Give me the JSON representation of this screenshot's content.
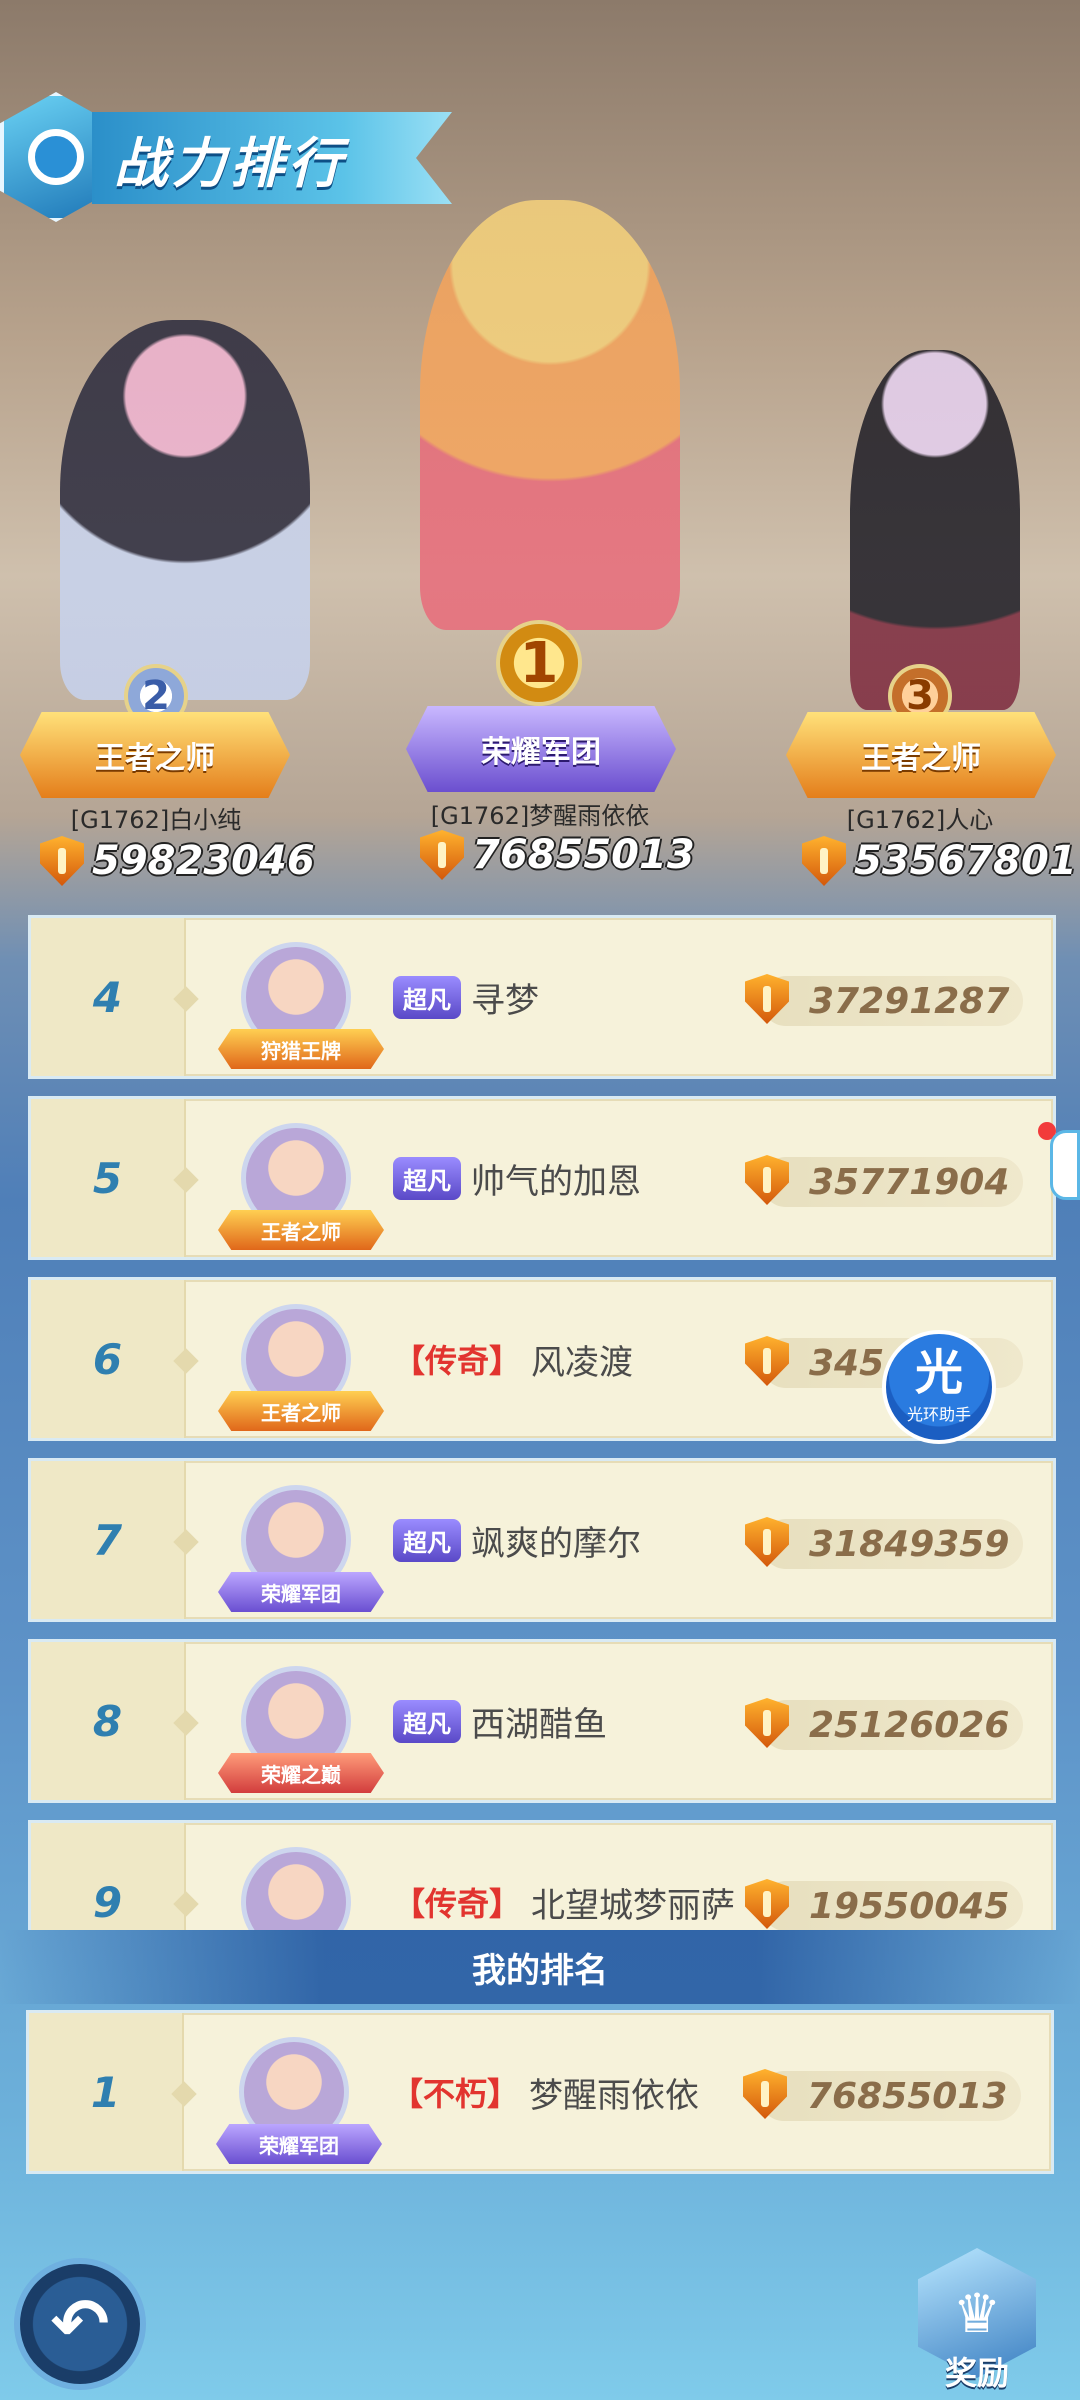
{
  "header": {
    "title": "战力排行"
  },
  "podium": [
    {
      "rank": "2",
      "emblem": "王者之师",
      "name": "[G1762]白小纯",
      "power": "59823046"
    },
    {
      "rank": "1",
      "emblem": "荣耀军团",
      "name": "[G1762]梦醒雨依依",
      "power": "76855013"
    },
    {
      "rank": "3",
      "emblem": "王者之师",
      "name": "[G1762]人心",
      "power": "53567801"
    }
  ],
  "rows": [
    {
      "rank": "4",
      "avatar_tag": "狩猎王牌",
      "title": "超凡",
      "name": "寻梦",
      "power": "37291287"
    },
    {
      "rank": "5",
      "avatar_tag": "王者之师",
      "title": "超凡",
      "name": "帅气的加恩",
      "power": "35771904"
    },
    {
      "rank": "6",
      "avatar_tag": "王者之师",
      "title": "【传奇】",
      "name": "风凌渡",
      "power": "345    3"
    },
    {
      "rank": "7",
      "avatar_tag": "荣耀军团",
      "title": "超凡",
      "name": "飒爽的摩尔",
      "power": "31849359"
    },
    {
      "rank": "8",
      "avatar_tag": "荣耀之巅",
      "title": "超凡",
      "name": "西湖醋鱼",
      "power": "25126026"
    },
    {
      "rank": "9",
      "avatar_tag": "",
      "title": "【传奇】",
      "name": "北望城梦丽萨",
      "power": "19550045"
    }
  ],
  "my_rank": {
    "label": "我的排名",
    "rank": "1",
    "avatar_tag": "荣耀军团",
    "title": "【不朽】",
    "name": "梦醒雨依依",
    "power": "76855013"
  },
  "assistant": {
    "glyph": "光",
    "label": "光环助手"
  },
  "buttons": {
    "back": "↶",
    "reward": "奖励"
  },
  "icons": {
    "shield": "power-shield-icon",
    "back": "back-arrow-icon",
    "reward": "crown-icon"
  }
}
